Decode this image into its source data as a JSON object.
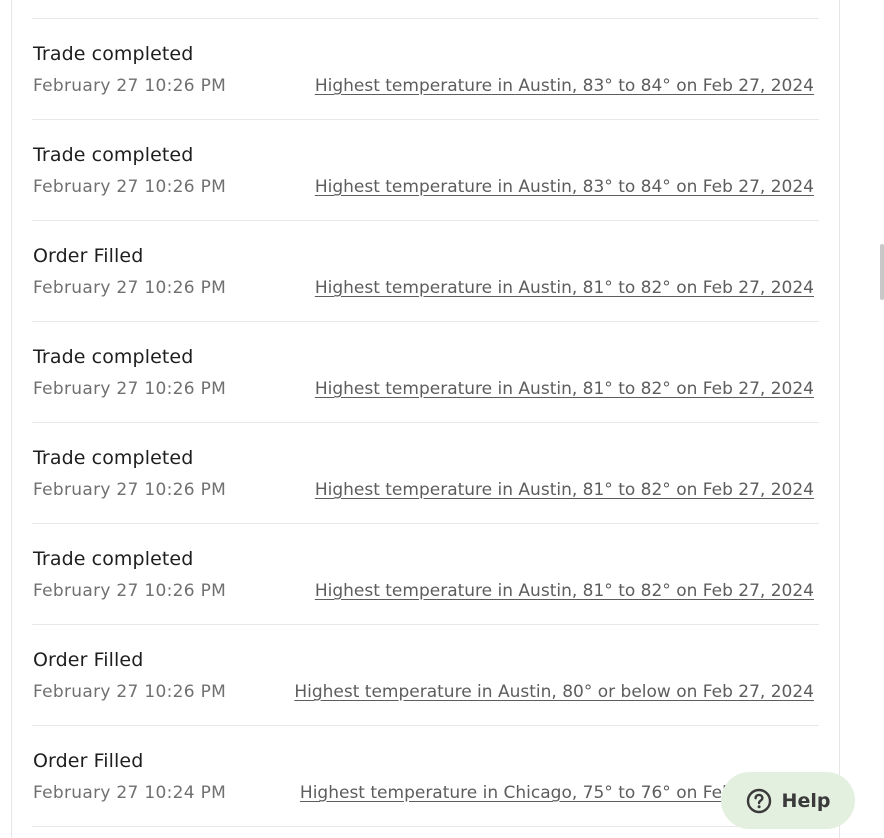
{
  "activity": {
    "items": [
      {
        "title": "Trade completed",
        "time": "February 27 10:26 PM",
        "market": "Highest temperature in Austin, 83° to 84° on Feb 27, 2024"
      },
      {
        "title": "Trade completed",
        "time": "February 27 10:26 PM",
        "market": "Highest temperature in Austin, 83° to 84° on Feb 27, 2024"
      },
      {
        "title": "Order Filled",
        "time": "February 27 10:26 PM",
        "market": "Highest temperature in Austin, 81° to 82° on Feb 27, 2024"
      },
      {
        "title": "Trade completed",
        "time": "February 27 10:26 PM",
        "market": "Highest temperature in Austin, 81° to 82° on Feb 27, 2024"
      },
      {
        "title": "Trade completed",
        "time": "February 27 10:26 PM",
        "market": "Highest temperature in Austin, 81° to 82° on Feb 27, 2024"
      },
      {
        "title": "Trade completed",
        "time": "February 27 10:26 PM",
        "market": "Highest temperature in Austin, 81° to 82° on Feb 27, 2024"
      },
      {
        "title": "Order Filled",
        "time": "February 27 10:26 PM",
        "market": "Highest temperature in Austin, 80° or below on Feb 27, 2024"
      },
      {
        "title": "Order Filled",
        "time": "February 27 10:24 PM",
        "market": "Highest temperature in Chicago, 75° to 76° on Feb 27, 2024"
      }
    ]
  },
  "help_widget": {
    "label": "Help",
    "icon": "question-circle-icon",
    "background_color": "#e3efdf"
  }
}
